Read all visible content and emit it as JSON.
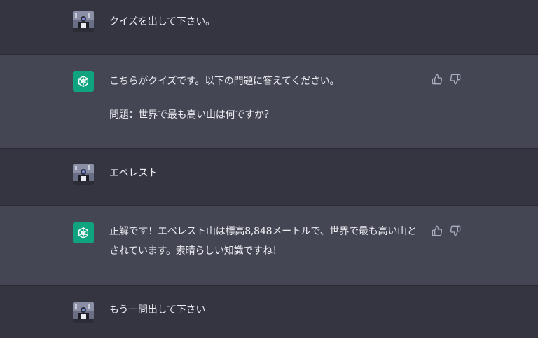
{
  "messages": [
    {
      "role": "user",
      "text": "クイズを出して下さい。"
    },
    {
      "role": "assistant",
      "paragraphs": [
        "こちらがクイズです。以下の問題に答えてください。",
        "問題：世界で最も高い山は何ですか？"
      ]
    },
    {
      "role": "user",
      "text": "エベレスト"
    },
    {
      "role": "assistant",
      "paragraphs": [
        "正解です！エベレスト山は標高8,848メートルで、世界で最も高い山とされています。素晴らしい知識ですね！"
      ]
    },
    {
      "role": "user",
      "text": "もう一問出して下さい"
    }
  ],
  "icons": {
    "user_avatar": "user-avatar",
    "assistant_avatar": "openai-logo-icon",
    "thumbs_up": "thumbs-up-icon",
    "thumbs_down": "thumbs-down-icon"
  },
  "colors": {
    "user_bg": "#343541",
    "assistant_bg": "#444654",
    "assistant_avatar_bg": "#10a37f",
    "text": "#ececf1",
    "icon": "#acacbe"
  }
}
